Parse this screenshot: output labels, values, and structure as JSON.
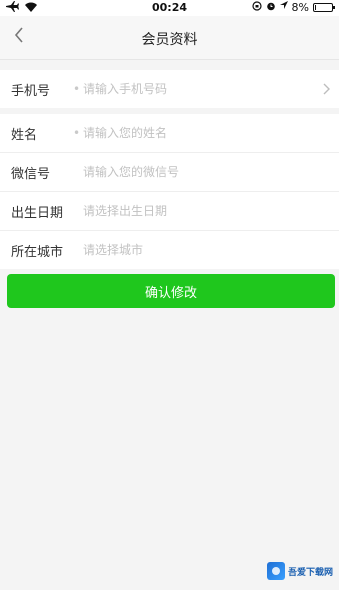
{
  "status_bar": {
    "time": "00:24",
    "battery_text": "8%",
    "battery_level": 0.08,
    "icons": [
      "airplane-icon",
      "wifi-icon",
      "rotation-lock-icon",
      "alarm-icon",
      "location-icon",
      "battery-icon"
    ]
  },
  "nav": {
    "title": "会员资料",
    "back_icon": "chevron-left-icon"
  },
  "form": {
    "phone": {
      "label": "手机号",
      "placeholder": "请输入手机号码"
    },
    "name": {
      "label": "姓名",
      "placeholder": "请输入您的姓名"
    },
    "wechat": {
      "label": "微信号",
      "placeholder": "请输入您的微信号"
    },
    "birthday": {
      "label": "出生日期",
      "placeholder": "请选择出生日期"
    },
    "city": {
      "label": "所在城市",
      "placeholder": "请选择城市"
    }
  },
  "confirm_label": "确认修改",
  "watermark": {
    "text": "吾爱下载网"
  },
  "colors": {
    "primary_green": "#1fc71d",
    "background": "#f4f4f4",
    "placeholder": "#c2c2c2"
  }
}
